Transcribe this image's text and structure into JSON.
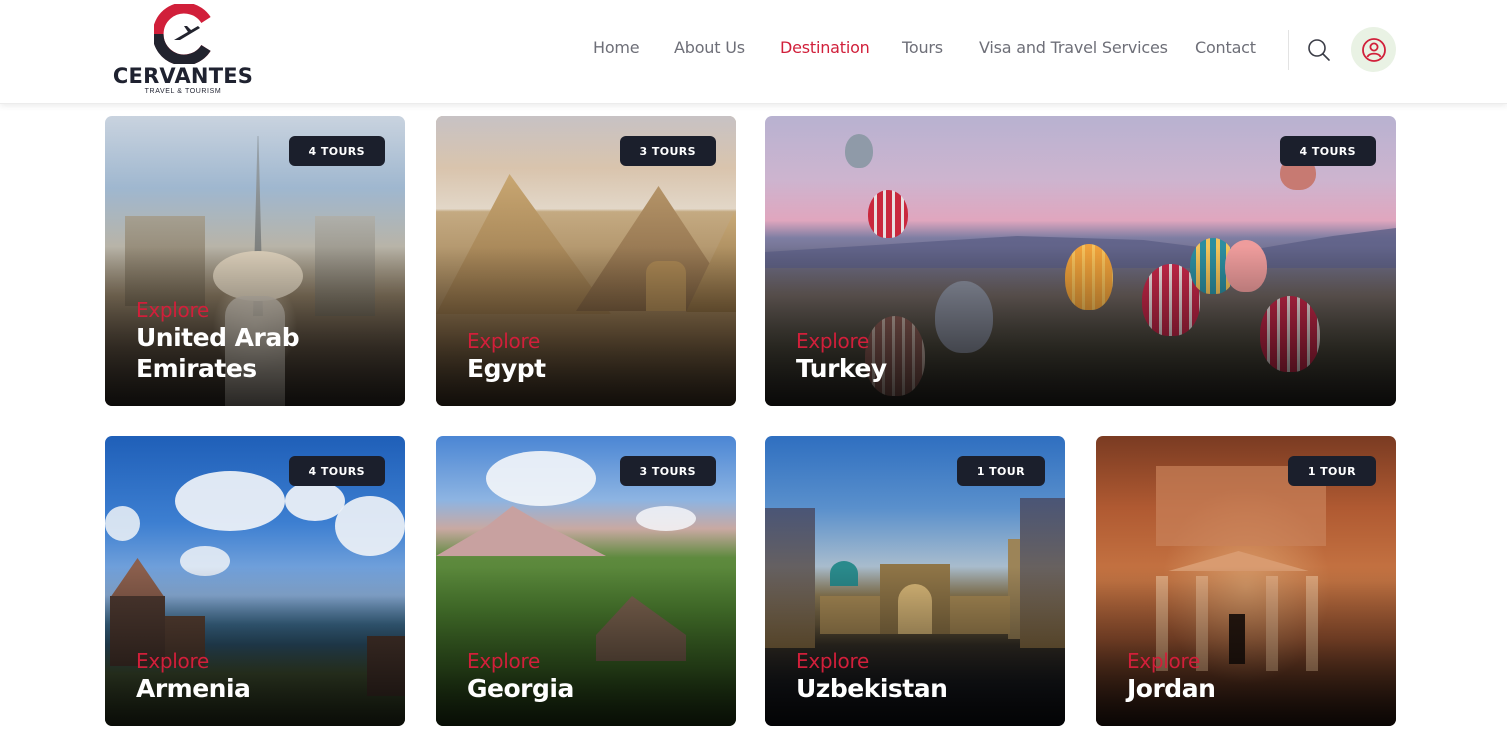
{
  "brand": {
    "name": "CERVANTES",
    "tagline": "TRAVEL & TOURISM",
    "logo_icon": "plane-c-logo-icon",
    "colors": {
      "primary": "#d11f3a",
      "dark": "#1f2230"
    }
  },
  "nav": {
    "items": [
      {
        "label": "Home",
        "active": false
      },
      {
        "label": "About Us",
        "active": false
      },
      {
        "label": "Destination",
        "active": true
      },
      {
        "label": "Tours",
        "active": false
      },
      {
        "label": "Visa and Travel Services",
        "active": false
      },
      {
        "label": "Contact",
        "active": false
      }
    ],
    "search_icon": "search-icon",
    "user_icon": "user-icon"
  },
  "destinations": [
    {
      "explore_label": "Explore",
      "country": "United Arab Emirates",
      "tours": "4 TOURS"
    },
    {
      "explore_label": "Explore",
      "country": "Egypt",
      "tours": "3 TOURS"
    },
    {
      "explore_label": "Explore",
      "country": "Turkey",
      "tours": "4 TOURS"
    },
    {
      "explore_label": "Explore",
      "country": "Armenia",
      "tours": "4 TOURS"
    },
    {
      "explore_label": "Explore",
      "country": "Georgia",
      "tours": "3 TOURS"
    },
    {
      "explore_label": "Explore",
      "country": "Uzbekistan",
      "tours": "1 TOUR"
    },
    {
      "explore_label": "Explore",
      "country": "Jordan",
      "tours": "1 TOUR"
    }
  ]
}
